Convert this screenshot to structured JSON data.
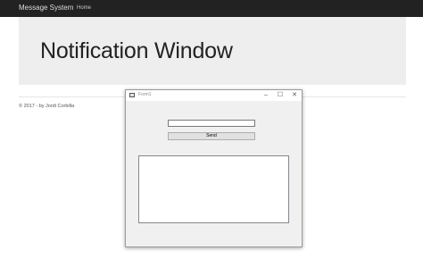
{
  "navbar": {
    "brand": "Message System",
    "links": [
      "Home"
    ]
  },
  "jumbotron": {
    "title": "Notification Window"
  },
  "footer": {
    "text": "© 2017 - by Jordi Corbilla"
  },
  "window": {
    "title": "Form1",
    "minimize_glyph": "–",
    "maximize_glyph": "☐",
    "close_glyph": "✕",
    "message_input_value": "",
    "send_label": "Send",
    "messages": []
  },
  "colors": {
    "navbar_bg": "#222222",
    "jumbotron_bg": "#eeeeee",
    "window_bg": "#f0f0f0"
  },
  "icons": [
    "app-window-icon",
    "minimize-icon",
    "maximize-icon",
    "close-icon"
  ]
}
